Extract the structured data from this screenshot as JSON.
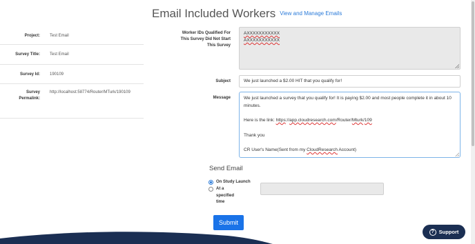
{
  "header": {
    "title": "Email Included Workers",
    "manage_link": "View and Manage Emails"
  },
  "sidebar": {
    "items": [
      {
        "label": "Project:",
        "value": "Test Email"
      },
      {
        "label": "Survey Title:",
        "value": "Test Email"
      },
      {
        "label": "Survey Id:",
        "value": "190109"
      },
      {
        "label": "Survey Permalink:",
        "value": "http://localhost:58774/Router/MTurk/190109"
      }
    ]
  },
  "form": {
    "worker_ids_label": "Worker IDs Qualified For This Survey Did Not Start This Survey",
    "worker_ids": [
      "AXXXXXXXXXXX",
      "AXXXXXXXXXXX"
    ],
    "subject_label": "Subject",
    "subject_value": "We just launched a $2.00 HIT that you qualify for!",
    "message_label": "Message",
    "message": {
      "line1": "We just launched a survey that you qualify for! It is paying $2.00 and most people complete it in about 10 minutes.",
      "link_prefix": "Here is the link: ",
      "link_https": "https",
      "link_colon": "://",
      "link_host": "app.cloudresearch.com",
      "link_router": "/Router/",
      "link_mturk": "Mturk",
      "link_slash": "/",
      "link_id": "109",
      "thanks": "Thank you",
      "signature_prefix": "CR User's Name(Sent from my ",
      "signature_brand": "CloudResearch",
      "signature_suffix": " Account)"
    }
  },
  "send_email": {
    "heading": "Send Email",
    "options": [
      {
        "label": "On Study Launch",
        "selected": true
      },
      {
        "label": "At a specified time",
        "selected": false
      }
    ],
    "time_value": ""
  },
  "buttons": {
    "submit": "Submit",
    "support": "Support"
  },
  "colors": {
    "accent": "#1a73e8",
    "link": "#2b7bd9",
    "support_bg": "#1b2f53",
    "wave": "#1b2f53"
  }
}
